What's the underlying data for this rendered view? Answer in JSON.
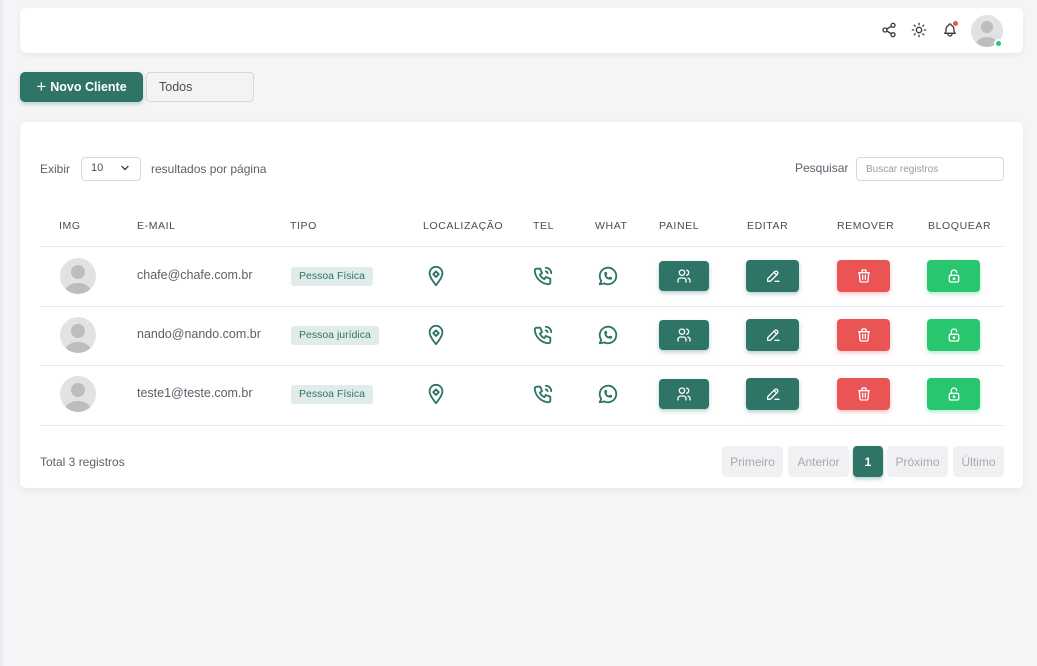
{
  "header": {
    "icons": [
      "share-icon",
      "sun-icon",
      "bell-icon",
      "user-avatar"
    ],
    "has_notification": true,
    "status": "online"
  },
  "actions": {
    "new_client_label": "Novo Cliente",
    "filter_value": "Todos"
  },
  "table_controls": {
    "show_label": "Exibir",
    "page_length": "10",
    "per_page_label": "resultados por página",
    "search_label": "Pesquisar",
    "search_placeholder": "Buscar registros"
  },
  "table": {
    "columns": [
      "IMG",
      "E-MAIL",
      "TIPO",
      "LOCALIZAÇÃO",
      "TEL",
      "WHAT",
      "PAINEL",
      "EDITAR",
      "REMOVER",
      "BLOQUEAR"
    ],
    "rows": [
      {
        "email": "chafe@chafe.com.br",
        "tipo": "Pessoa Física"
      },
      {
        "email": "nando@nando.com.br",
        "tipo": "Pessoa jurídica"
      },
      {
        "email": "teste1@teste.com.br",
        "tipo": "Pessoa Física"
      }
    ]
  },
  "footer": {
    "total": "Total 3 registros",
    "pagination": [
      "Primeiro",
      "Anterior",
      "1",
      "Próximo",
      "Último"
    ],
    "current_page": "1"
  },
  "colors": {
    "primary": "#2e7467",
    "danger": "#ea5455",
    "success": "#28c76f",
    "badge_bg": "#e1ecea"
  }
}
